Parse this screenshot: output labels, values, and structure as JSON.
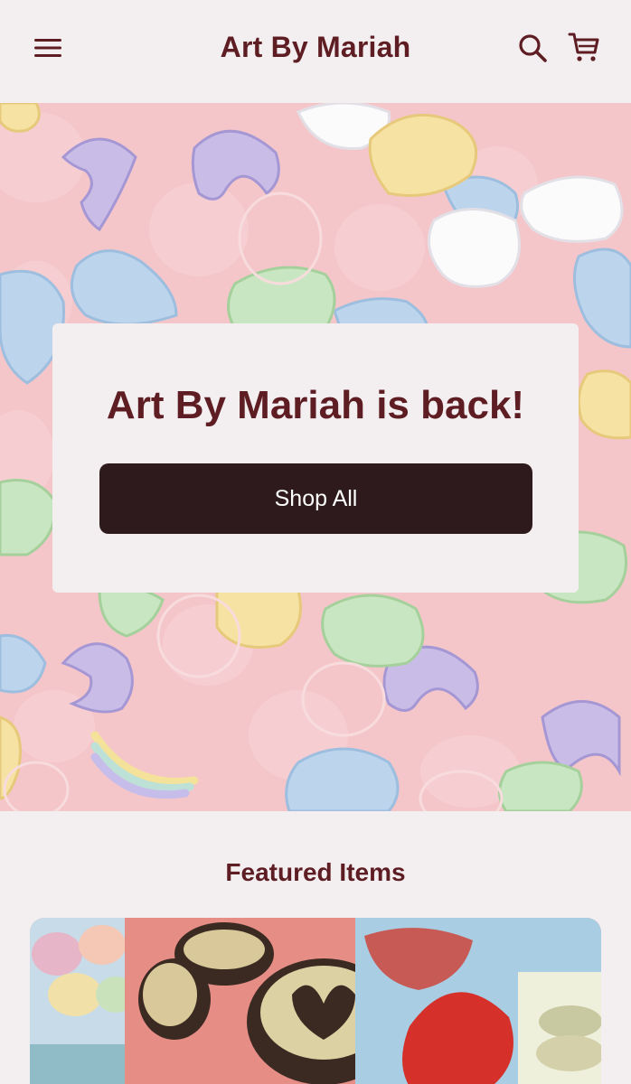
{
  "header": {
    "title": "Art By Mariah",
    "menu_icon": "hamburger-menu-icon",
    "search_icon": "search-icon",
    "cart_icon": "cart-icon"
  },
  "hero": {
    "heading": "Art By Mariah is back!",
    "button_label": "Shop All"
  },
  "featured": {
    "title": "Featured Items"
  },
  "colors": {
    "page_background": "#f3eff1",
    "brand_text": "#5e1d22",
    "button_background": "#2e1a1c",
    "hero_pink": "#f3c4c7"
  }
}
